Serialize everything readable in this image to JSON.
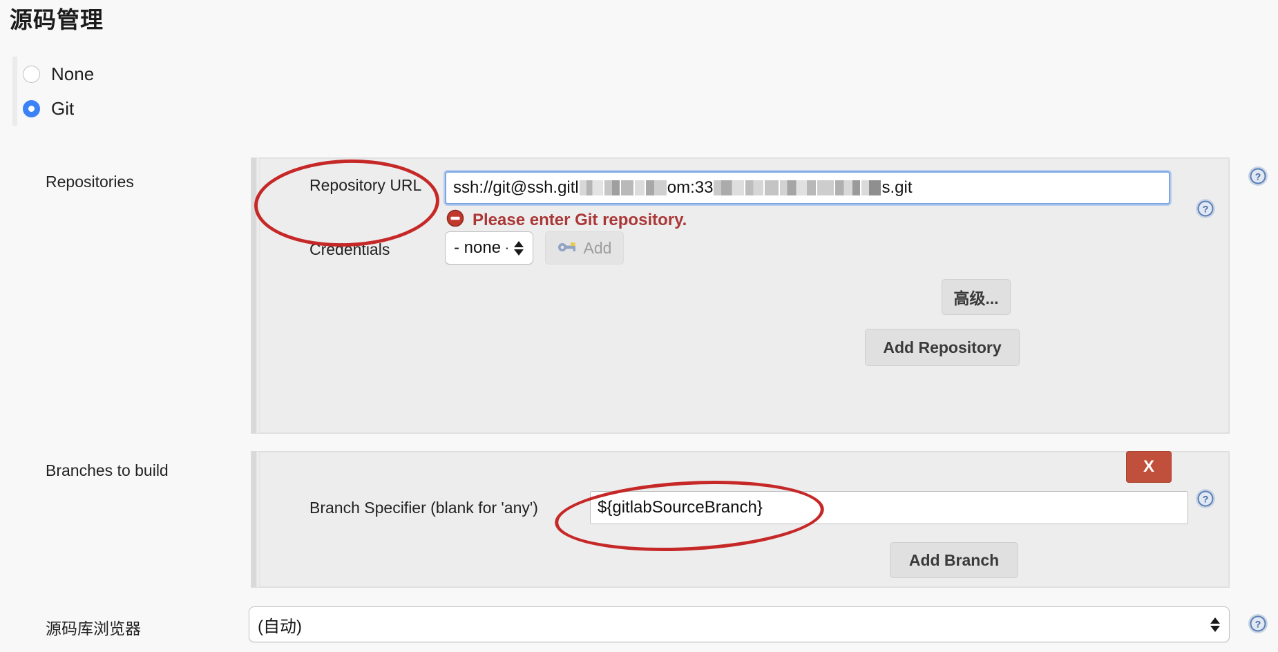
{
  "page": {
    "title": "源码管理",
    "accent_blue": "#3b82f6",
    "annotation_red": "#c62828",
    "error_red": "#ab3737",
    "danger_button": "#c0503c"
  },
  "scm_type": {
    "options": [
      {
        "label": "None",
        "selected": false
      },
      {
        "label": "Git",
        "selected": true
      }
    ]
  },
  "repositories": {
    "section_label": "Repositories",
    "repository_url": {
      "label": "Repository URL",
      "value_prefix": "ssh://git@ssh.gitl",
      "value_middle": "om:33",
      "value_suffix": "s.git",
      "redacted": true,
      "focused": true
    },
    "validation_error": {
      "icon": "error-stop-icon",
      "message": "Please enter Git repository."
    },
    "credentials": {
      "label": "Credentials",
      "selected": "- none -",
      "add_button": {
        "label": "Add",
        "icon": "key-icon",
        "disabled": true
      }
    },
    "advanced_button": "高级...",
    "add_repository_button": "Add Repository"
  },
  "branches": {
    "section_label": "Branches to build",
    "delete_button": "X",
    "branch_specifier": {
      "label": "Branch Specifier (blank for 'any')",
      "value": "${gitlabSourceBranch}"
    },
    "add_branch_button": "Add Branch"
  },
  "repository_browser": {
    "label": "源码库浏览器",
    "selected": "(自动)"
  },
  "help_icons": [
    {
      "name": "help-icon-repositories"
    },
    {
      "name": "help-icon-repository-url"
    },
    {
      "name": "help-icon-branches"
    },
    {
      "name": "help-icon-branch-specifier"
    },
    {
      "name": "help-icon-repository-browser"
    }
  ]
}
